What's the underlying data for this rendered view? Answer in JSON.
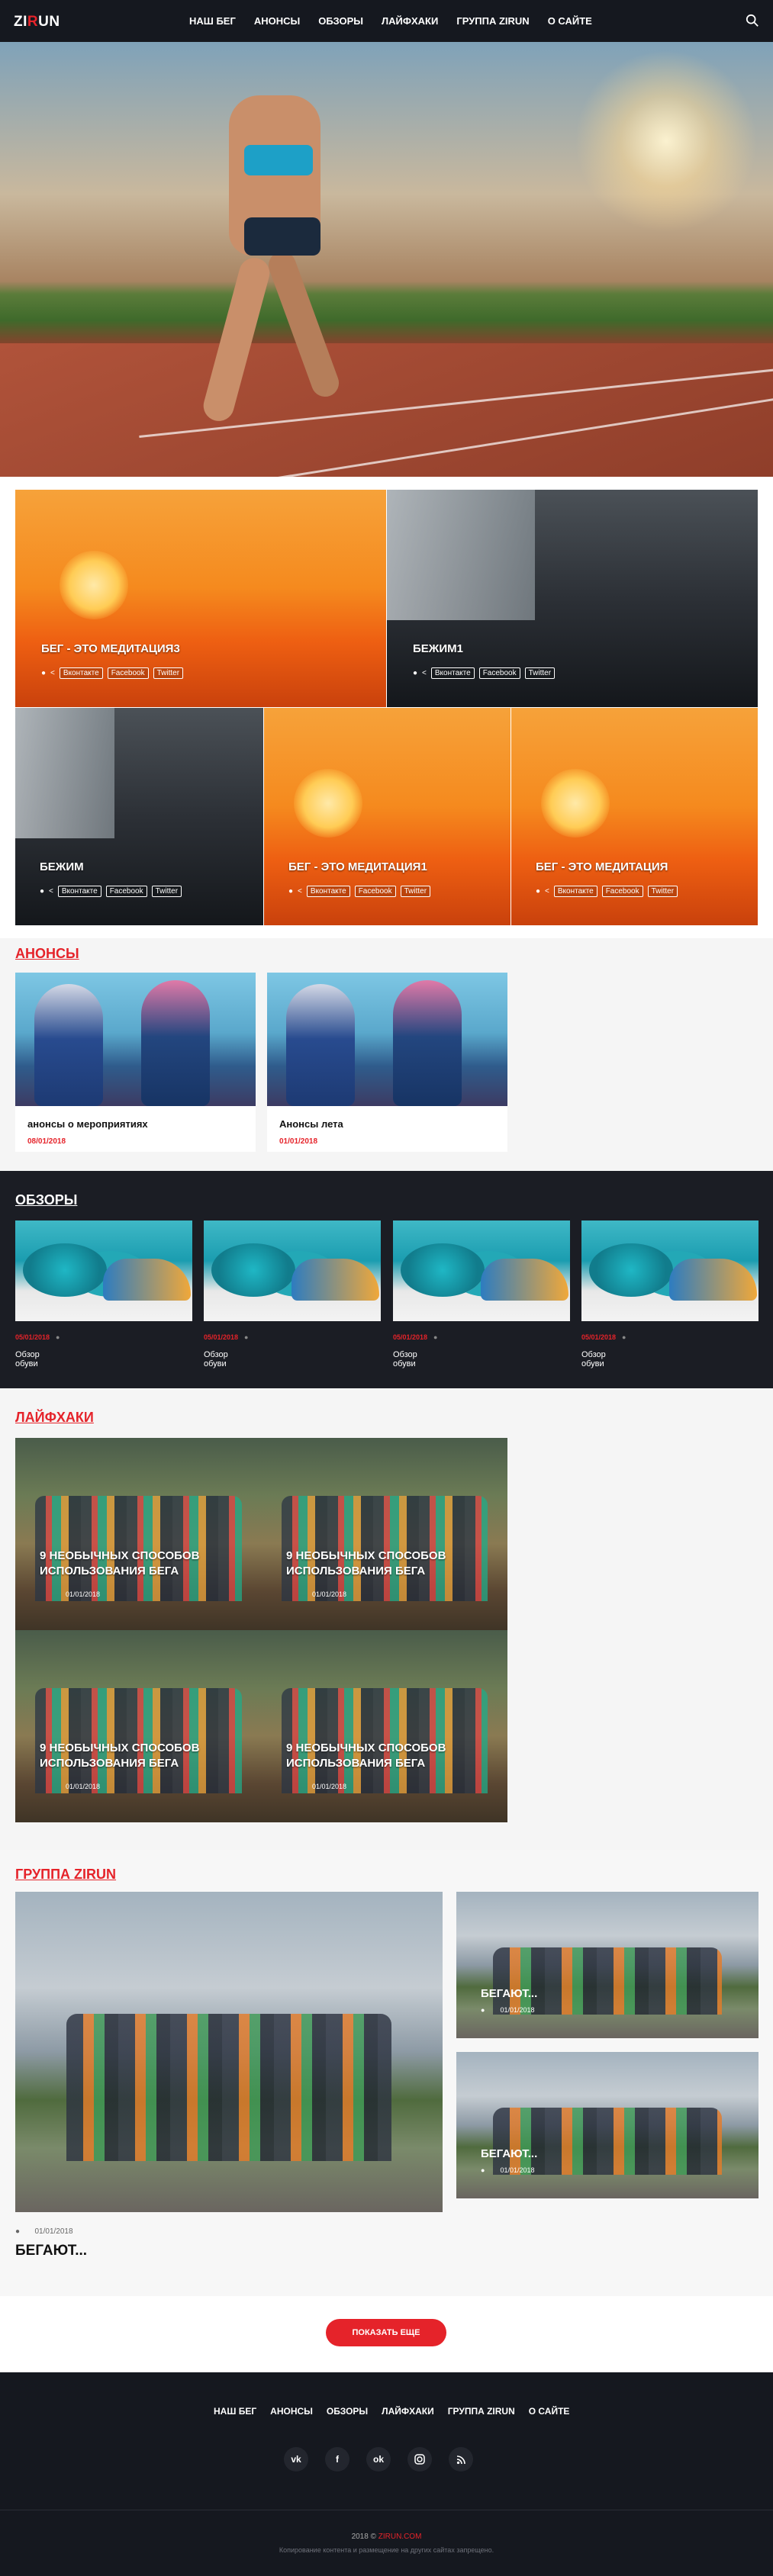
{
  "header": {
    "logo": "ZIRUN",
    "nav": [
      "НАШ БЕГ",
      "АНОНСЫ",
      "ОБЗОРЫ",
      "ЛАЙФХАКИ",
      "ГРУППА ZIRUN",
      "О САЙТЕ"
    ]
  },
  "share": {
    "vk": "Вконтакте",
    "fb": "Facebook",
    "tw": "Twitter"
  },
  "featured": [
    {
      "title": "БЕГ - ЭТО МЕДИТАЦИЯ3"
    },
    {
      "title": "БЕЖИМ1"
    },
    {
      "title": "БЕЖИМ"
    },
    {
      "title": "БЕГ - ЭТО МЕДИТАЦИЯ1"
    },
    {
      "title": "БЕГ - ЭТО МЕДИТАЦИЯ"
    }
  ],
  "anons": {
    "section_title": "АНОНСЫ",
    "cards": [
      {
        "title": "анонсы о мероприятиях",
        "date": "08/01/2018"
      },
      {
        "title": "Анонсы лета",
        "date": "01/01/2018"
      }
    ]
  },
  "reviews": {
    "section_title": "ОБЗОРЫ",
    "items": [
      {
        "date": "05/01/2018",
        "title": "Обзор обуви"
      },
      {
        "date": "05/01/2018",
        "title": "Обзор обуви"
      },
      {
        "date": "05/01/2018",
        "title": "Обзор обуви"
      },
      {
        "date": "05/01/2018",
        "title": "Обзор обуви"
      }
    ]
  },
  "lifehacks": {
    "section_title": "ЛАЙФХАКИ",
    "items": [
      {
        "title": "9 НЕОБЫЧНЫХ СПОСОБОВ ИСПОЛЬЗОВАНИЯ БЕГА",
        "date": "01/01/2018"
      },
      {
        "title": "9 НЕОБЫЧНЫХ СПОСОБОВ ИСПОЛЬЗОВАНИЯ БЕГА",
        "date": "01/01/2018"
      },
      {
        "title": "9 НЕОБЫЧНЫХ СПОСОБОВ ИСПОЛЬЗОВАНИЯ БЕГА",
        "date": "01/01/2018"
      },
      {
        "title": "9 НЕОБЫЧНЫХ СПОСОБОВ ИСПОЛЬЗОВАНИЯ БЕГА",
        "date": "01/01/2018"
      }
    ]
  },
  "group": {
    "section_title": "ГРУППА ZIRUN",
    "main": {
      "title": "БЕГАЮТ...",
      "date": "01/01/2018"
    },
    "side": [
      {
        "title": "БЕГАЮТ...",
        "date": "01/01/2018"
      },
      {
        "title": "БЕГАЮТ...",
        "date": "01/01/2018"
      }
    ]
  },
  "more_button": "ПОКАЗАТЬ ЕЩЕ",
  "footer": {
    "nav": [
      "НАШ БЕГ",
      "АНОНСЫ",
      "ОБЗОРЫ",
      "ЛАЙФХАКИ",
      "ГРУППА ZIRUN",
      "О САЙТЕ"
    ],
    "socials": [
      "vk-icon",
      "facebook-icon",
      "odnoklassniki-icon",
      "instagram-icon",
      "rss-icon"
    ],
    "copyright_year": "2018 ©",
    "copyright_site": "ZIRUN.COM",
    "copyright_note": "Копирование контента и размещение на других сайтах запрещено."
  },
  "colors": {
    "accent": "#e5232a",
    "dark": "#15181f"
  }
}
